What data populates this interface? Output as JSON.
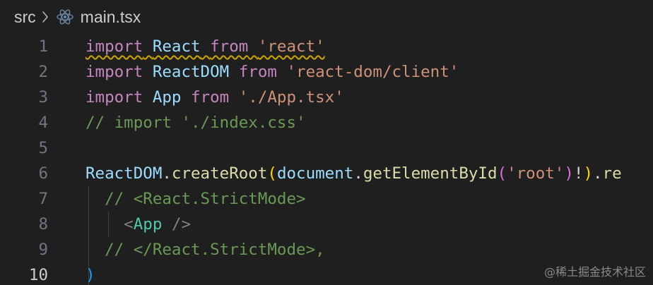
{
  "breadcrumb": {
    "folder": "src",
    "file": "main.tsx",
    "file_icon": "react-icon",
    "separator_icon": "chevron-right-icon"
  },
  "editor": {
    "line_numbers": [
      "1",
      "2",
      "3",
      "4",
      "5",
      "6",
      "7",
      "8",
      "9",
      "10"
    ],
    "active_line": 10,
    "lines": [
      [
        {
          "t": "import",
          "c": "kw"
        },
        {
          "t": " ",
          "c": "punct"
        },
        {
          "t": "React",
          "c": "var"
        },
        {
          "t": " ",
          "c": "punct"
        },
        {
          "t": "from",
          "c": "kw"
        },
        {
          "t": " ",
          "c": "punct"
        },
        {
          "t": "'react'",
          "c": "str"
        }
      ],
      [
        {
          "t": "import",
          "c": "kw"
        },
        {
          "t": " ",
          "c": "punct"
        },
        {
          "t": "ReactDOM",
          "c": "var"
        },
        {
          "t": " ",
          "c": "punct"
        },
        {
          "t": "from",
          "c": "kw"
        },
        {
          "t": " ",
          "c": "punct"
        },
        {
          "t": "'react-dom/client'",
          "c": "str"
        }
      ],
      [
        {
          "t": "import",
          "c": "kw"
        },
        {
          "t": " ",
          "c": "punct"
        },
        {
          "t": "App",
          "c": "var"
        },
        {
          "t": " ",
          "c": "punct"
        },
        {
          "t": "from",
          "c": "kw"
        },
        {
          "t": " ",
          "c": "punct"
        },
        {
          "t": "'./App.tsx'",
          "c": "str"
        }
      ],
      [
        {
          "t": "// import './index.css'",
          "c": "cm"
        }
      ],
      [],
      [
        {
          "t": "ReactDOM",
          "c": "var"
        },
        {
          "t": ".",
          "c": "punct"
        },
        {
          "t": "createRoot",
          "c": "fn"
        },
        {
          "t": "(",
          "c": "br1"
        },
        {
          "t": "document",
          "c": "var"
        },
        {
          "t": ".",
          "c": "punct"
        },
        {
          "t": "getElementById",
          "c": "fn"
        },
        {
          "t": "(",
          "c": "br2"
        },
        {
          "t": "'root'",
          "c": "str"
        },
        {
          "t": ")",
          "c": "br2"
        },
        {
          "t": "!",
          "c": "punct"
        },
        {
          "t": ")",
          "c": "br1"
        },
        {
          "t": ".",
          "c": "punct"
        },
        {
          "t": "re",
          "c": "fn"
        }
      ],
      [
        {
          "t": "  ",
          "c": "punct"
        },
        {
          "t": "// <React.StrictMode>",
          "c": "cm"
        }
      ],
      [
        {
          "t": "    ",
          "c": "punct"
        },
        {
          "t": "<",
          "c": "tagp"
        },
        {
          "t": "App",
          "c": "tag"
        },
        {
          "t": " />",
          "c": "tagp"
        }
      ],
      [
        {
          "t": "  ",
          "c": "punct"
        },
        {
          "t": "// </React.StrictMode>,",
          "c": "cm"
        }
      ],
      [
        {
          "t": ")",
          "c": "br3"
        }
      ]
    ]
  },
  "diagnostics": {
    "warning_line": 1,
    "warning_color": "#cca700"
  },
  "watermark": "@稀土掘金技术社区"
}
